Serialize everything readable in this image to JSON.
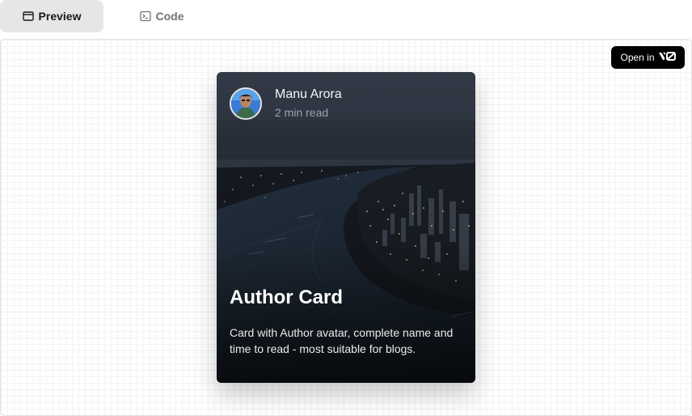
{
  "tabs": {
    "preview_label": "Preview",
    "code_label": "Code"
  },
  "open_in": {
    "label": "Open in"
  },
  "card": {
    "author_name": "Manu Arora",
    "read_time": "2 min read",
    "title": "Author Card",
    "description": "Card with Author avatar, complete name and time to read - most suitable for blogs."
  },
  "icons": {
    "preview": "browser-window-icon",
    "code": "terminal-icon",
    "brand": "v0-logo-icon"
  },
  "colors": {
    "active_tab_bg": "#e6e6e6",
    "open_in_bg": "#000000",
    "card_bg_dark": "#0e1013"
  }
}
